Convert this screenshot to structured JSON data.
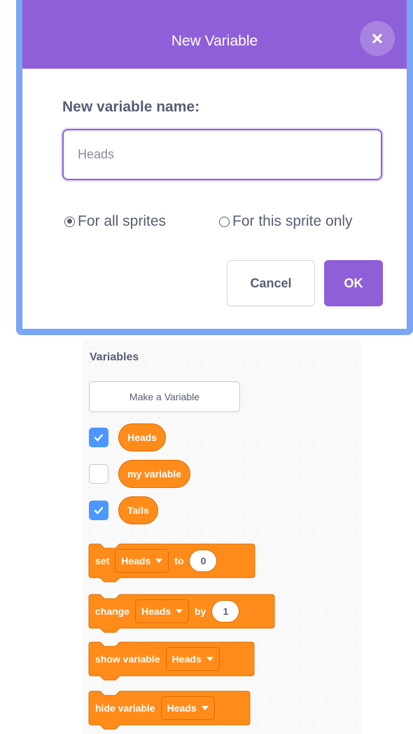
{
  "dialog": {
    "title": "New Variable",
    "name_label": "New variable name:",
    "name_value": "Heads",
    "scope_options": [
      {
        "label": "For all sprites",
        "selected": true
      },
      {
        "label": "For this sprite only",
        "selected": false
      }
    ],
    "cancel_label": "Cancel",
    "ok_label": "OK"
  },
  "palette": {
    "title": "Variables",
    "make_variable_label": "Make a Variable",
    "variables": [
      {
        "name": "Heads",
        "checked": true
      },
      {
        "name": "my variable",
        "checked": false
      },
      {
        "name": "Tails",
        "checked": true
      }
    ],
    "blocks": {
      "set": {
        "word": "set",
        "var": "Heads",
        "joiner": "to",
        "value": "0"
      },
      "change": {
        "word": "change",
        "var": "Heads",
        "joiner": "by",
        "value": "1"
      },
      "show": {
        "word": "show variable",
        "var": "Heads"
      },
      "hide": {
        "word": "hide variable",
        "var": "Heads"
      }
    }
  },
  "colors": {
    "header": "#8f5fd9",
    "accent": "#8f5fd9",
    "variables_orange": "#ff8c1a",
    "checkbox_blue": "#4c97ff",
    "frame_blue": "#7aa6f5"
  }
}
